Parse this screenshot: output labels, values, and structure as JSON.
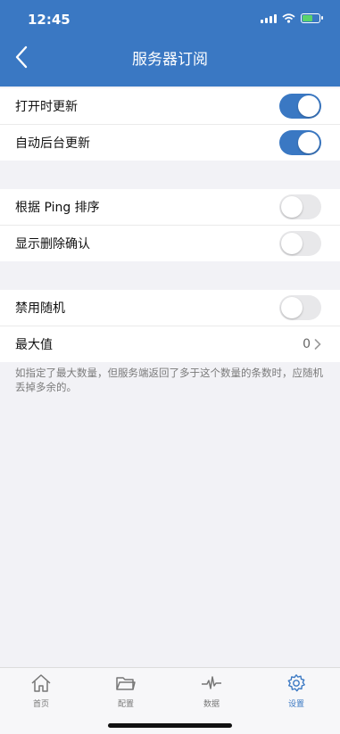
{
  "status": {
    "time": "12:45"
  },
  "header": {
    "title": "服务器订阅"
  },
  "groups": [
    {
      "items": [
        {
          "label": "打开时更新",
          "toggle": true
        },
        {
          "label": "自动后台更新",
          "toggle": true
        }
      ]
    },
    {
      "items": [
        {
          "label": "根据 Ping 排序",
          "toggle": false
        },
        {
          "label": "显示删除确认",
          "toggle": false
        }
      ]
    },
    {
      "items": [
        {
          "label": "禁用随机",
          "toggle": false
        },
        {
          "label": "最大值",
          "value": "0"
        }
      ]
    }
  ],
  "note": "如指定了最大数量，但服务端返回了多于这个数量的条数时，应随机丢掉多余的。",
  "tabs": [
    {
      "label": "首页",
      "icon": "home-icon"
    },
    {
      "label": "配置",
      "icon": "folder-icon"
    },
    {
      "label": "数据",
      "icon": "pulse-icon"
    },
    {
      "label": "设置",
      "icon": "gear-icon",
      "active": true
    }
  ],
  "colors": {
    "accent": "#3a78c3",
    "background": "#f2f2f6"
  }
}
